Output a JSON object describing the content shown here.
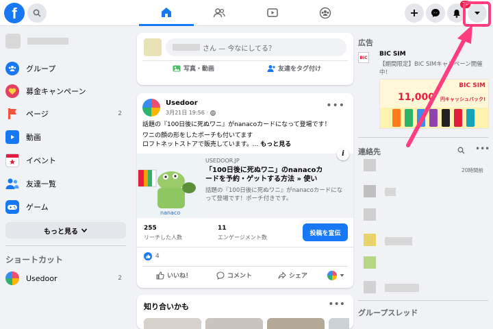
{
  "topbar": {
    "logo_letter": "f",
    "nav_tabs": [
      "home-icon",
      "friends-icon",
      "watch-icon",
      "groups-icon"
    ],
    "right_buttons": [
      "create-icon",
      "messenger-icon",
      "notifications-icon",
      "account-menu-icon"
    ],
    "notif_badge": "7+"
  },
  "sidebar": {
    "items": [
      {
        "label": "グループ",
        "icon": "groups-icon",
        "color": "#1877f2"
      },
      {
        "label": "募金キャンペーン",
        "icon": "fundraiser-icon",
        "color": "#e4405f"
      },
      {
        "label": "ページ",
        "icon": "pages-icon",
        "color": "#f5533d",
        "count": "2"
      },
      {
        "label": "動画",
        "icon": "watch-icon",
        "color": "#1877f2"
      },
      {
        "label": "イベント",
        "icon": "events-icon",
        "color": "#e41e3f"
      },
      {
        "label": "友達一覧",
        "icon": "friends-icon",
        "color": "#1877f2"
      },
      {
        "label": "ゲーム",
        "icon": "gaming-icon",
        "color": "#1877f2"
      }
    ],
    "more_label": "もっと見る",
    "shortcuts_title": "ショートカット",
    "shortcut": {
      "label": "Usedoor",
      "count": "2"
    }
  },
  "composer": {
    "placeholder": "さん — 今なにしてる？",
    "photo_label": "写真・動画",
    "tag_label": "友達をタグ付け"
  },
  "post": {
    "author": "Usedoor",
    "meta": "3月21日 19:56 ·",
    "text_line1": "話題の『100日後に死ぬワニ』がnanacoカードになって登場です！",
    "text_line2": "ワニの顔の形をしたポーチも付いてます",
    "text_line3": "ロフトネットストアで販売しています。...",
    "see_more": "もっと見る",
    "link": {
      "domain": "USEDOOR.JP",
      "title": "「100日後に死ぬワニ」のnanacoカードを予約・ゲットする方法 » 使い方・方...",
      "desc": "話題の『100日後に死ぬワニ』がnanacoカードになって登場です！ポーチ付きです。",
      "image_text": "nanaco"
    },
    "reach_num": "255",
    "reach_label": "リーチした人数",
    "engage_num": "11",
    "engage_label": "エンゲージメント数",
    "boost_label": "投稿を宣伝",
    "like_count": "4",
    "like_label": "いいね！",
    "comment_label": "コメント",
    "share_label": "シェア"
  },
  "pymk": {
    "title": "知り合いかも"
  },
  "right": {
    "ad_title": "広告",
    "ad_name": "BIC SIM",
    "ad_desc": "【期間限定】BIC SIMキャンペーン開催中！",
    "ad_banner_brand": "BIC SIM",
    "ad_banner_amount": "11,000",
    "ad_banner_tail": "円キャッシュバック!",
    "contacts_title": "連絡先",
    "contact_time": "20時間前",
    "group_threads_title": "グループスレッド"
  },
  "colors": {
    "brand": "#1877f2",
    "highlight": "#ff3d7f"
  }
}
